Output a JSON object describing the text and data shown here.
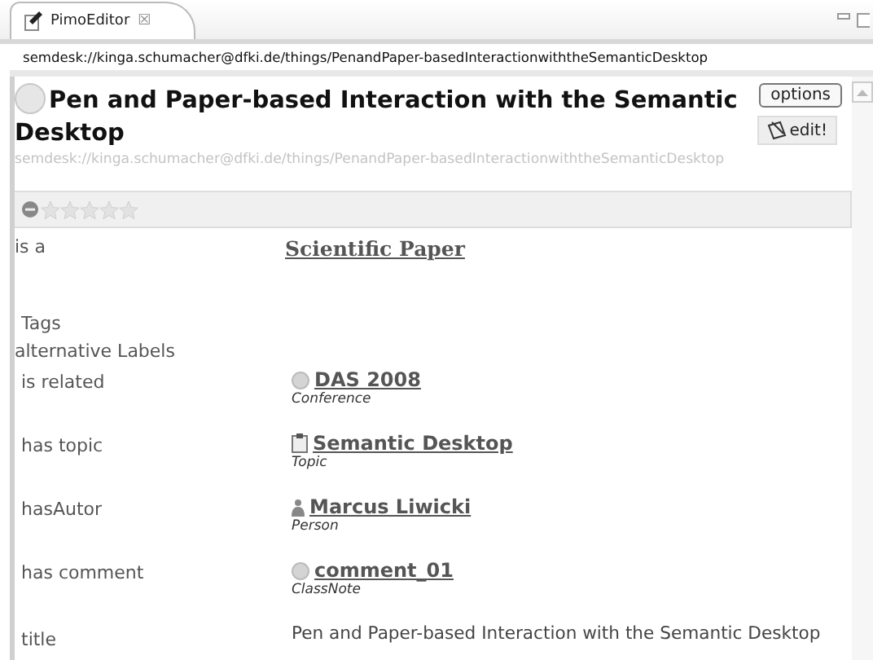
{
  "tab": {
    "label": "PimoEditor",
    "close": "☒",
    "selected": true
  },
  "address": "semdesk://kinga.schumacher@dfki.de/things/PenandPaper-basedInteractionwiththeSemanticDesktop",
  "title": "Pen and Paper-based Interaction with the Semantic Desktop",
  "uri": "semdesk://kinga.schumacher@dfki.de/things/PenandPaper-basedInteractionwiththeSemanticDesktop",
  "buttons": {
    "options": "options",
    "edit": "edit!"
  },
  "rating": {
    "stars": 0
  },
  "properties": [
    {
      "label": "is a",
      "kind": "link",
      "value": "Scientific Paper"
    },
    {
      "label": "Tags",
      "kind": "empty"
    },
    {
      "label": "alternative Labels",
      "kind": "empty"
    },
    {
      "label": "is related",
      "kind": "thing",
      "value": "DAS 2008",
      "type": "Conference"
    },
    {
      "label": "has topic",
      "kind": "topic",
      "value": "Semantic Desktop",
      "type": "Topic"
    },
    {
      "label": "hasAutor",
      "kind": "person",
      "value": "Marcus Liwicki",
      "type": "Person"
    },
    {
      "label": "has comment",
      "kind": "thing",
      "value": "comment_01",
      "type": "ClassNote"
    },
    {
      "label": "title",
      "kind": "text",
      "value": "Pen and Paper-based Interaction with the Semantic Desktop"
    }
  ]
}
